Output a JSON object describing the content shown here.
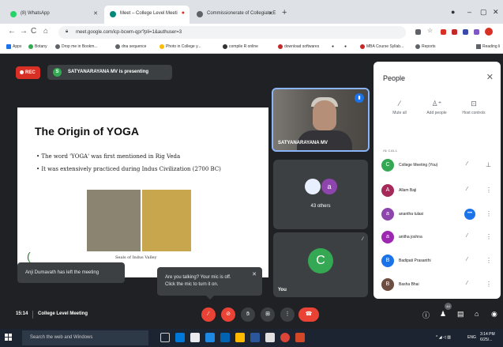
{
  "browser": {
    "tabs": [
      {
        "label": "(8) WhatsApp",
        "favicon_color": "#25d366"
      },
      {
        "label": "Meet – College Level Meeti",
        "favicon_color": "#00897b"
      },
      {
        "label": "Commissionerate of Collegiate E",
        "favicon_color": "#5f6368"
      }
    ],
    "url": "meet.google.com/icp-bcwm-qpr?pli=1&authuser=3",
    "bookmarks": [
      "Apps",
      "Botany",
      "Drop me in Bookm...",
      "dna sequence",
      "Photo in College y...",
      "compile R online",
      "download softwares",
      "MBA Course Syllab...",
      "Reports"
    ],
    "reading_list": "Reading li"
  },
  "meet": {
    "rec_label": "REC",
    "presenter_initial": "S",
    "presenting_text": "SATYANARAYANA MV is presenting",
    "slide": {
      "title": "The Origin of YOGA",
      "bullets": [
        "• The word 'YOGA' was first mentioned in Rig Veda",
        "• It was extensively practiced during Indus Civilization (2700 BC)"
      ],
      "caption": "Seals of Indus Valley"
    },
    "tiles": {
      "presenter_name": "SATYANARAYANA MV",
      "others_avatar_initial": "a",
      "others_count": "43 others",
      "you_initial": "C",
      "you_label": "You"
    },
    "toasts": {
      "left_meeting": "Anji Dumavath has left the meeting",
      "mic_off_line1": "Are you talking? Your mic is off.",
      "mic_off_line2": "Click the mic to turn it on."
    },
    "people_panel": {
      "title": "People",
      "actions": [
        {
          "icon": "mute-all-icon",
          "label": "Mute all"
        },
        {
          "icon": "add-people-icon",
          "label": "Add people"
        },
        {
          "icon": "host-controls-icon",
          "label": "Host controls"
        }
      ],
      "section": "IN CALL",
      "participants": [
        {
          "name": "College Meeting (You)",
          "initial": "C",
          "color": "#34a853",
          "mic": "muted",
          "pinned": true
        },
        {
          "name": "Allam Baji",
          "initial": "A",
          "color": "#a52a5a",
          "mic": "muted",
          "pinned": false
        },
        {
          "name": "anantha tulasi",
          "initial": "a",
          "color": "#8e44ad",
          "mic": "speaking",
          "pinned": false
        },
        {
          "name": "anitha joshna",
          "initial": "a",
          "color": "#9c27b0",
          "mic": "muted",
          "pinned": false
        },
        {
          "name": "Badipati Prasanthi",
          "initial": "B",
          "color": "#1a73e8",
          "mic": "muted",
          "pinned": false
        },
        {
          "name": "Basha Bhai",
          "initial": "B",
          "color": "#6d4c41",
          "mic": "muted",
          "pinned": false
        }
      ]
    },
    "bottom_bar": {
      "time": "15:14",
      "meeting_name": "College Level Meeting",
      "participant_badge": "44"
    }
  },
  "taskbar": {
    "search_placeholder": "Search the web and Windows",
    "lang": "ENG",
    "time": "3:14 PM",
    "date": "6/25/..."
  }
}
